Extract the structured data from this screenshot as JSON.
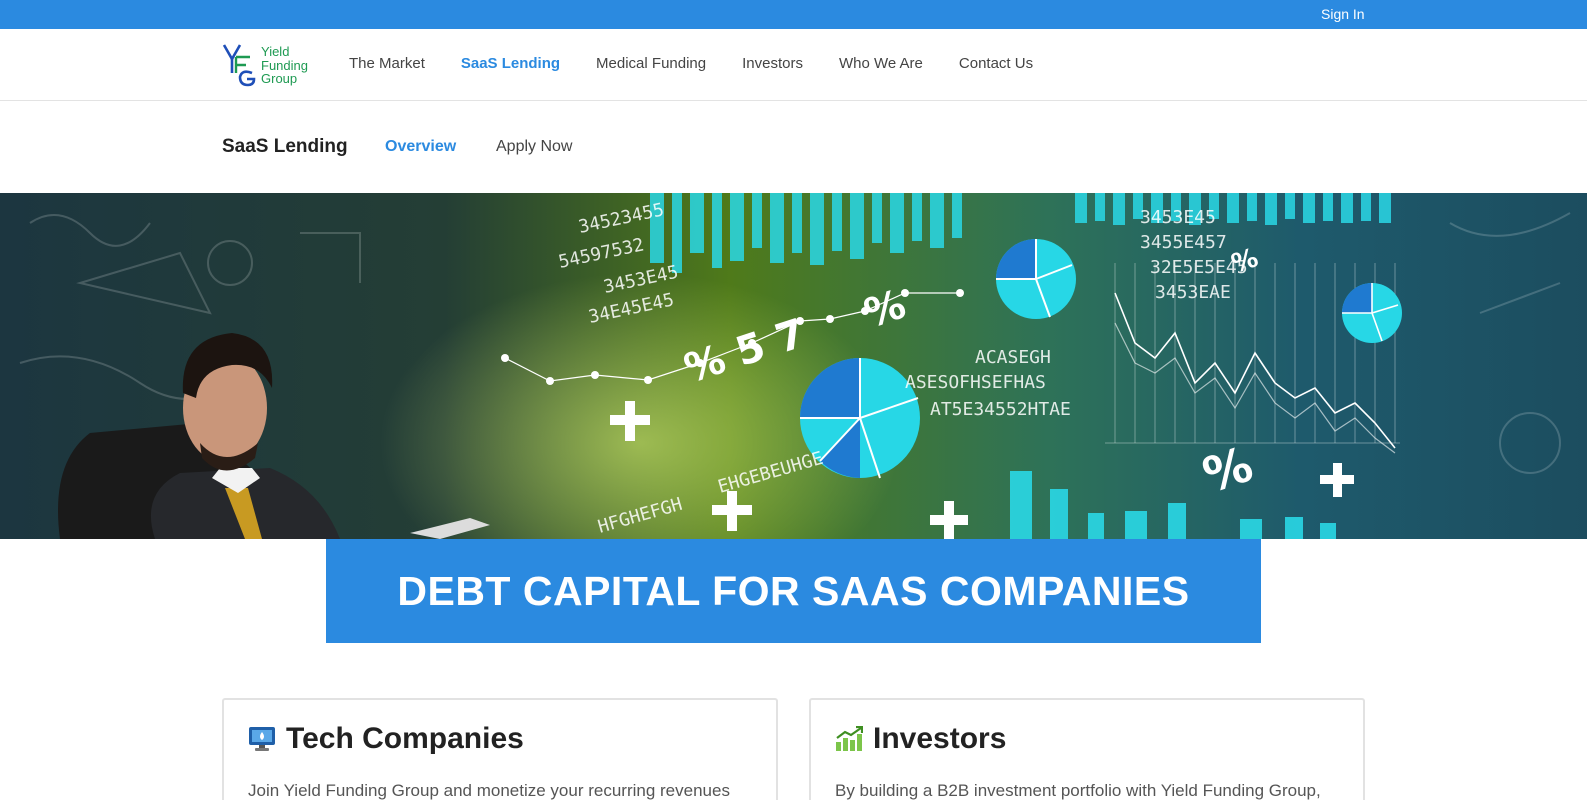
{
  "topbar": {
    "sign_in": "Sign In"
  },
  "logo": {
    "line1": "Yield",
    "line2": "Funding",
    "line3": "Group",
    "icon": "yfg-logo-mark"
  },
  "nav": {
    "items": [
      {
        "label": "The Market"
      },
      {
        "label": "SaaS Lending",
        "active": true
      },
      {
        "label": "Medical Funding"
      },
      {
        "label": "Investors"
      },
      {
        "label": "Who We Are"
      },
      {
        "label": "Contact Us"
      }
    ]
  },
  "subnav": {
    "title": "SaaS Lending",
    "overview": "Overview",
    "apply": "Apply Now"
  },
  "hero": {
    "image": "businessman-finance-chalkboard"
  },
  "banner": {
    "heading": "DEBT CAPITAL FOR SAAS COMPANIES"
  },
  "cards": [
    {
      "title": "Tech Companies",
      "icon": "monitor-icon",
      "body": "Join Yield Funding Group and monetize your recurring revenues"
    },
    {
      "title": "Investors",
      "icon": "growth-chart-icon",
      "body": "By building a B2B investment portfolio with Yield Funding Group,"
    }
  ],
  "colors": {
    "accent": "#2b8ae0",
    "logo_green": "#1e9a52",
    "logo_blue": "#1f4fb8"
  }
}
